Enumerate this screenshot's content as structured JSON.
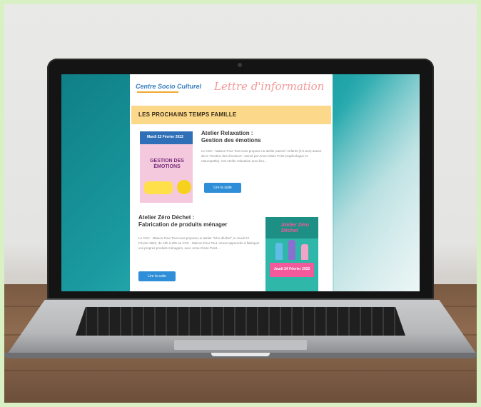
{
  "email": {
    "logo_text": "Centre Socio Culturel",
    "header_title": "Lettre d'information",
    "section_title": "LES PROCHAINS TEMPS FAMILLE",
    "article1": {
      "title_line1": "Atelier Relaxation :",
      "title_line2": "Gestion des émotions",
      "body": "Le CSC - Maison Pour Tout vous propose un atelier parent / enfants (2-5 ans) autour de la \"Gestion des émotions\", animé par Anne-Claire Point (sophrologue et naturopathe). Cet Atelier relaxation aura lieu...",
      "button": "Lire la suite",
      "poster_date": "Mardi 22 Février 2022",
      "poster_title": "GESTION DES ÉMOTIONS"
    },
    "article2": {
      "title_line1": "Atelier Zéro Déchet :",
      "title_line2": "Fabrication de produits ménager",
      "body": "Le CSC - Maison Pour Tout vous propose un atelier \"zéro déchet\", le Jeudi 24 Février 2022, de 18h à 20h au CSC - Maison Pour Tout. Venez apprendre à fabriquer vos propres produits ménagers, avec Anne-Claire Point...",
      "button": "Lire la suite",
      "poster_title": "Atelier Zéro Déchet",
      "poster_date": "Jeudi 24 Février 2022"
    }
  }
}
